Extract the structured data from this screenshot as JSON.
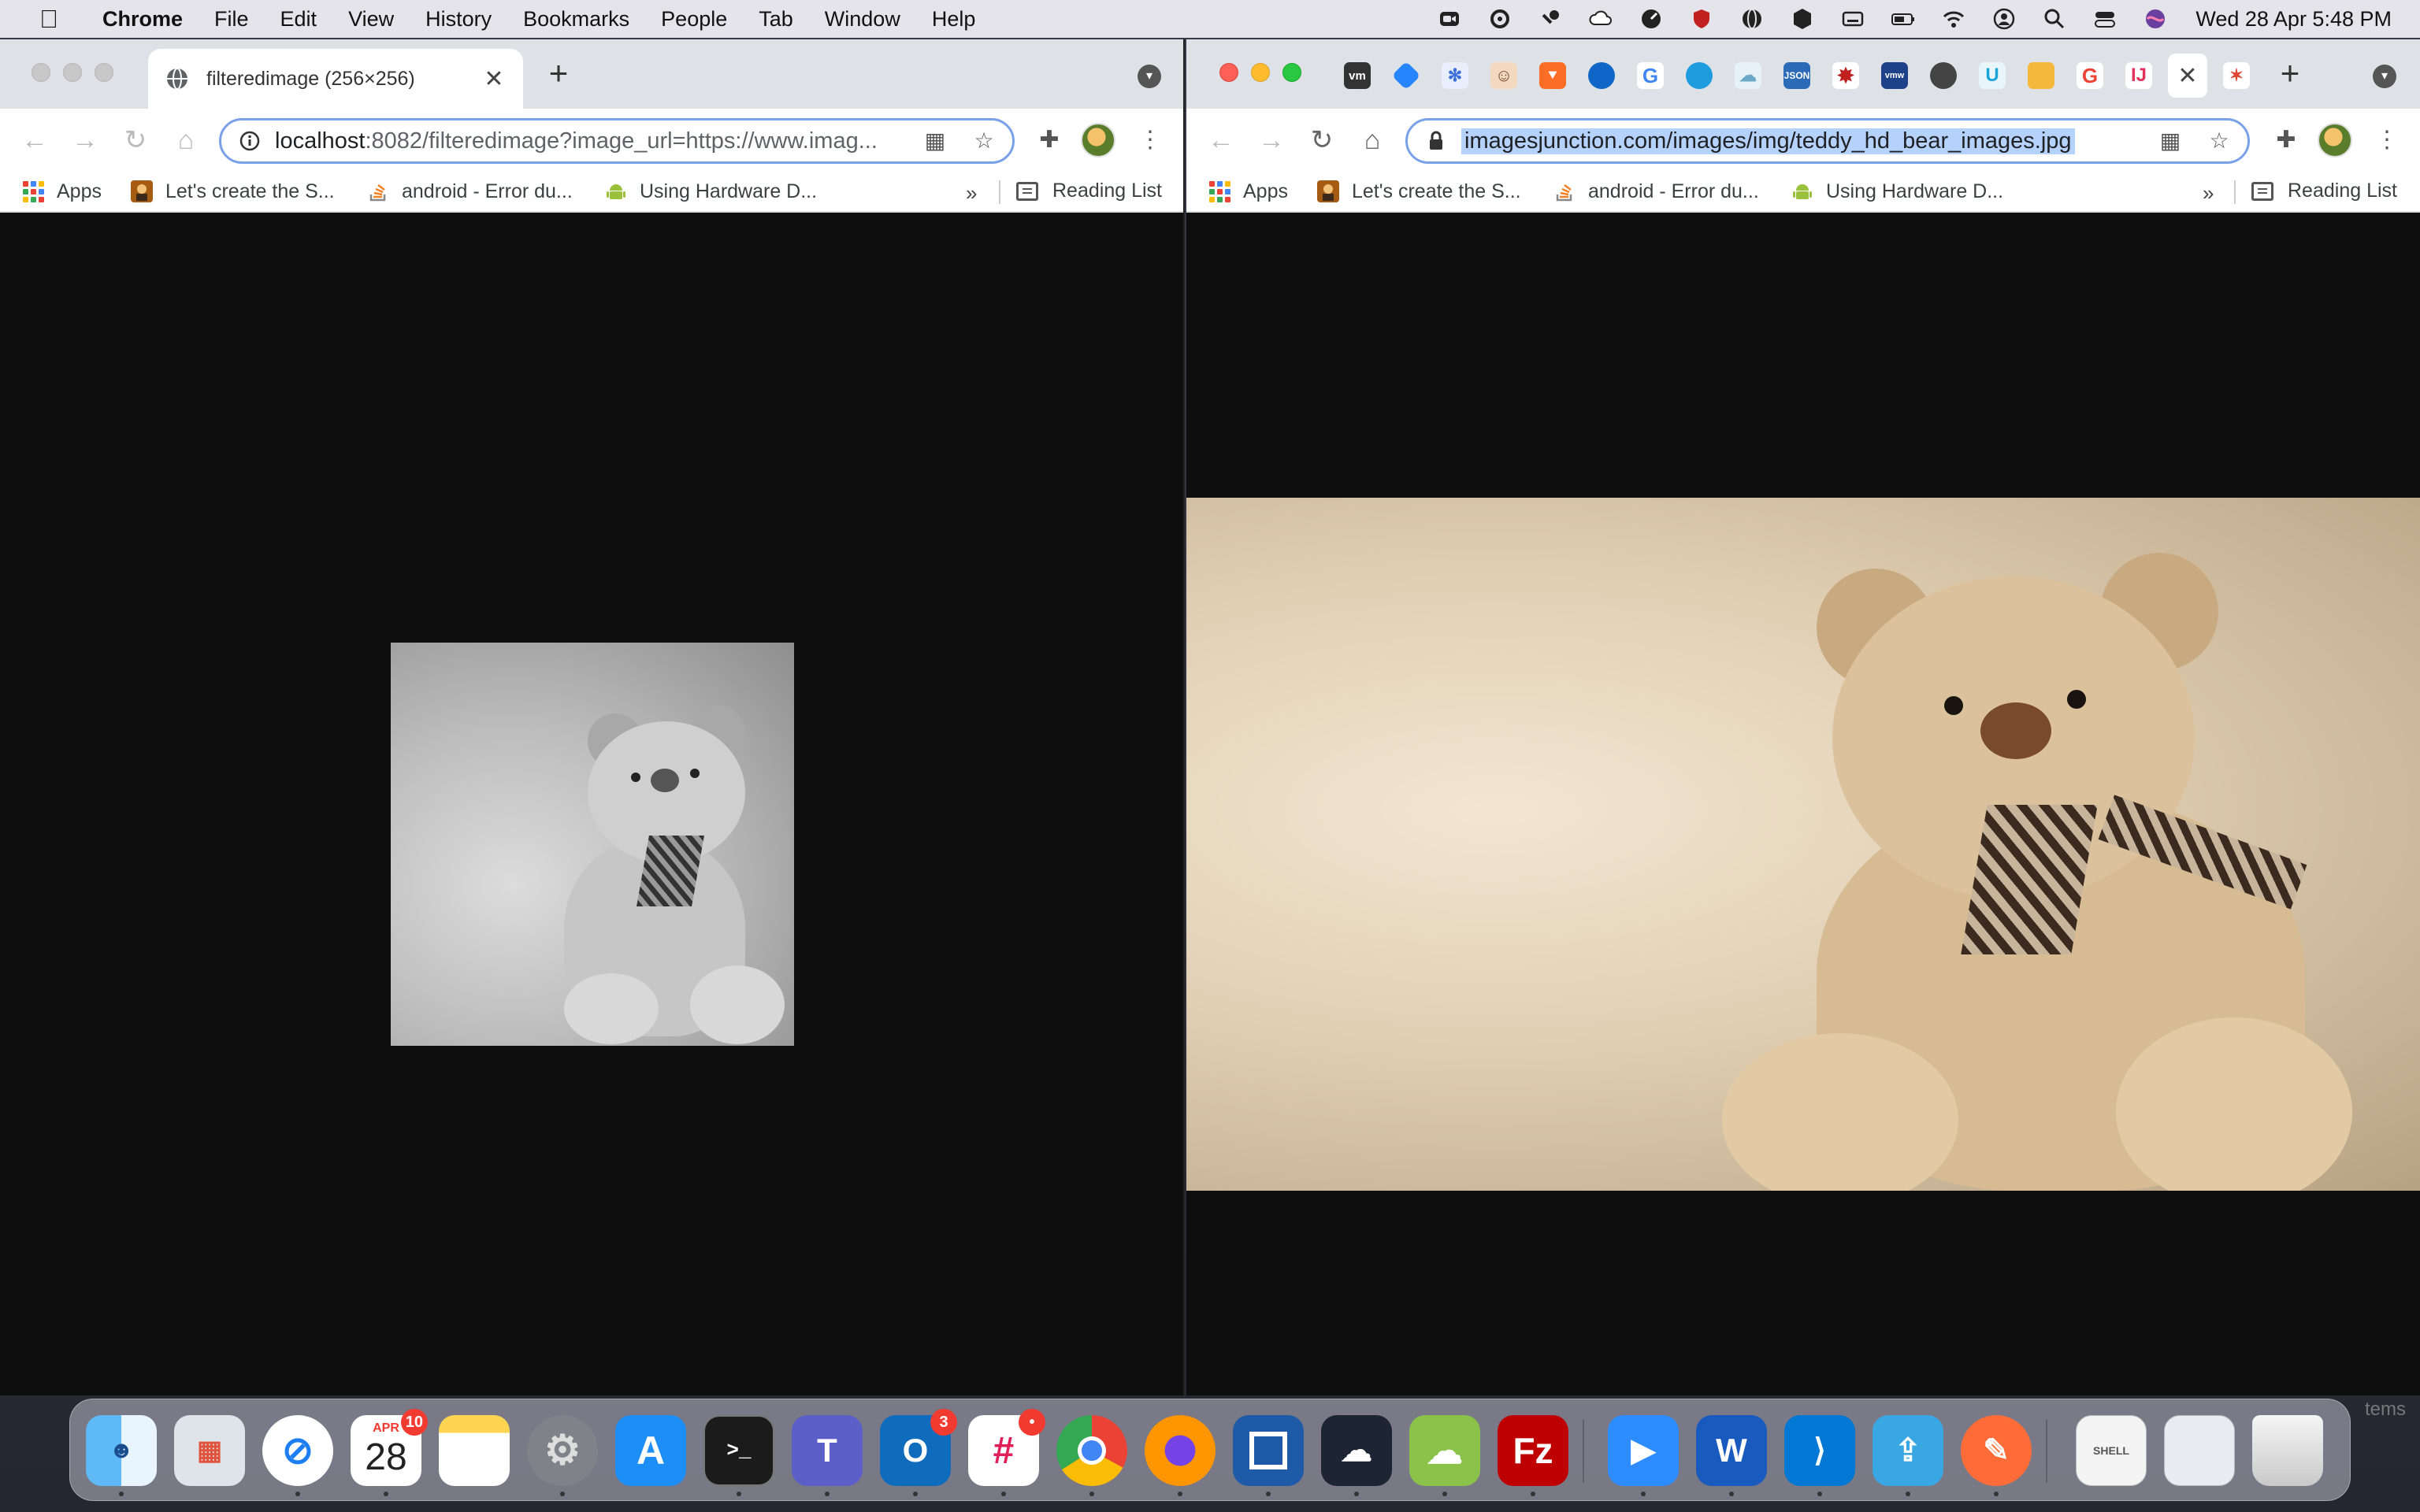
{
  "menubar": {
    "app_name": "Chrome",
    "items": [
      "File",
      "Edit",
      "View",
      "History",
      "Bookmarks",
      "People",
      "Tab",
      "Window",
      "Help"
    ],
    "clock": "Wed 28 Apr  5:48 PM"
  },
  "left_window": {
    "tab_title": "filteredimage (256×256)",
    "url_host": "localhost",
    "url_rest": ":8082/filteredimage?image_url=https://www.imag...",
    "bookmarks": [
      {
        "label": "Apps",
        "icon": "apps-grid-icon"
      },
      {
        "label": "Let's create the S...",
        "icon": "avatar-icon"
      },
      {
        "label": "android - Error du...",
        "icon": "stackoverflow-icon"
      },
      {
        "label": "Using Hardware D...",
        "icon": "android-icon"
      }
    ],
    "more_bookmarks": "»",
    "reading_list": "Reading List"
  },
  "right_window": {
    "url": "imagesjunction.com/images/img/teddy_hd_bear_images.jpg",
    "pinned_tabs": [
      "vm",
      "jira",
      "nx",
      "user",
      "gitlab",
      "onedrive",
      "G",
      "salesforce",
      "cloud",
      "json",
      "bug",
      "vmw",
      "web",
      "udemy",
      "box",
      "G",
      "intellij"
    ],
    "bookmarks": [
      {
        "label": "Apps",
        "icon": "apps-grid-icon"
      },
      {
        "label": "Let's create the S...",
        "icon": "avatar-icon"
      },
      {
        "label": "android - Error du...",
        "icon": "stackoverflow-icon"
      },
      {
        "label": "Using Hardware D...",
        "icon": "android-icon"
      }
    ],
    "more_bookmarks": "»",
    "reading_list": "Reading List"
  },
  "dock": {
    "calendar_month": "APR",
    "calendar_day": "28",
    "calendar_badge": "10",
    "outlook_badge": "3",
    "slack_badge": "•",
    "apps": [
      "finder",
      "launchpad",
      "safari",
      "calendar",
      "notes",
      "system-preferences",
      "app-store",
      "terminal",
      "teams",
      "outlook",
      "slack",
      "chrome",
      "firefox",
      "sourcetree",
      "cloud-shell",
      "cloud-app",
      "filezilla",
      "zoom",
      "word",
      "vscode",
      "screen-share",
      "postman",
      "shell-script",
      "preview",
      "trash"
    ],
    "items_label": "tems"
  },
  "colors": {
    "menubar_bg": "#e4e4ea",
    "tabstrip_bg": "#dee1e6",
    "content_bg": "#0e0e0e",
    "accent": "#1a73e8"
  }
}
